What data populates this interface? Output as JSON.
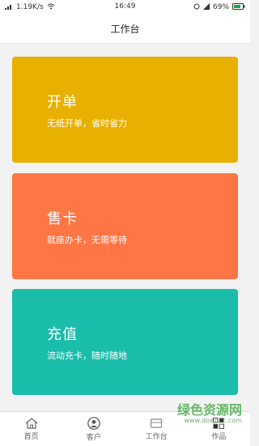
{
  "status_bar": {
    "signal": "1.19K/s",
    "time": "16:49",
    "battery": "69%"
  },
  "header": {
    "title": "工作台"
  },
  "cards": [
    {
      "title": "开单",
      "subtitle": "无纸开单，省时省力",
      "color": "#e8b000"
    },
    {
      "title": "售卡",
      "subtitle": "就座办卡，无需等待",
      "color": "#ff7646"
    },
    {
      "title": "充值",
      "subtitle": "流动充卡，随时随地",
      "color": "#1abcaa"
    }
  ],
  "tabs": [
    {
      "label": "首页",
      "icon": "home-icon"
    },
    {
      "label": "客户",
      "icon": "user-icon"
    },
    {
      "label": "工作台",
      "icon": "workbench-icon"
    },
    {
      "label": "作品",
      "icon": "grid-icon"
    }
  ],
  "watermark": {
    "text": "绿色资源网",
    "url": "www.downcc.com"
  }
}
